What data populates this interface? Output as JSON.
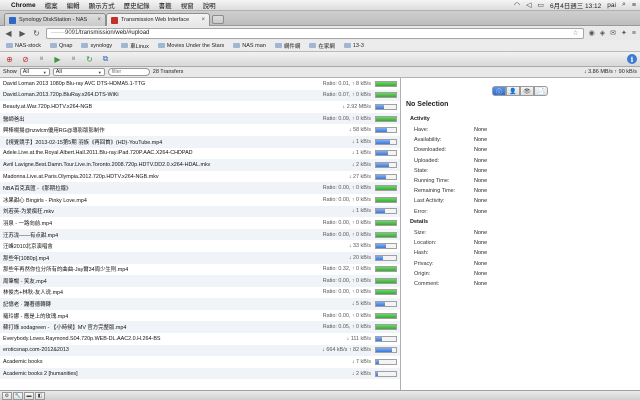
{
  "menubar": {
    "app_name": "Chrome",
    "items": [
      "檔案",
      "編輯",
      "顯示方式",
      "歷史紀錄",
      "書籤",
      "視窗",
      "說明"
    ],
    "clock": "6月4日週三 13:12",
    "user": "pai"
  },
  "tabs": [
    {
      "title": "Synology DiskStation - NAS",
      "close": "×",
      "favicon_color": "#2f67c4"
    },
    {
      "title": "Transmission Web Interface",
      "close": "×",
      "favicon_color": "#c4302b"
    }
  ],
  "address": {
    "url_host": "·······9091",
    "url_path": "/transmission/web/#upload"
  },
  "bookmarks": [
    "NAS-stock",
    "Qnap",
    "synology",
    "車Linux",
    "Movies Under the Stars",
    "NAS man",
    "網件網",
    "在家網",
    "13-3"
  ],
  "filter": {
    "show_label": "Show",
    "status_select": "All",
    "tracker_select": "All",
    "search_placeholder": "filter",
    "count": "28 Transfers",
    "speeds": "↓ 3.86 MB/s  ↑ 90 kB/s"
  },
  "torrents": [
    {
      "name": "David Loman 2013 1080p Blu-ray AVC DTS-HDMA5.1-TTG",
      "stats": "Ratio: 0.01, ↑ 8 kB/s",
      "progress": 100,
      "state": "seed"
    },
    {
      "name": "David.Loman.2013.720p.BluRay.x264.DTS-WiKi",
      "stats": "Ratio: 0.07, ↑ 0 kB/s",
      "progress": 100,
      "state": "seed"
    },
    {
      "name": "Beauty.at.War.720p.HDTV.x264-NGB",
      "stats": "↓ 2.92 MB/s",
      "progress": 40,
      "state": "dl"
    },
    {
      "name": "醫師爸出",
      "stats": "Ratio: 0.09, ↑ 0 kB/s",
      "progress": 100,
      "state": "seed"
    },
    {
      "name": "興棒楊揚@nzwlcm優用RG@導影版影制作",
      "stats": "↓ 58 kB/s",
      "progress": 55,
      "state": "dl"
    },
    {
      "name": "【視覺競手】2013-02-15第5期 羽族《再回首》(HD)-YouTube.mp4",
      "stats": "↓ 1 kB/s",
      "progress": 70,
      "state": "dl"
    },
    {
      "name": "Adele.Live.at.the.Royal.Albert.Hall.2011.Blu-ray.iPad.720P.AAC.X264-CHDPAD",
      "stats": "↓ 1 kB/s",
      "progress": 60,
      "state": "dl"
    },
    {
      "name": "Avril Lavigne.Best.Damn.Tour.Live.in.Toronto.2008.720p.HDTV.DD2.0.x264-HDAL.mkv",
      "stats": "↓ 2 kB/s",
      "progress": 65,
      "state": "dl"
    },
    {
      "name": "Madonna.Live.at.Paris.Olympia.2012.720p.HDTV.x264-NGB.mkv",
      "stats": "↓ 27 kB/s",
      "progress": 50,
      "state": "dl"
    },
    {
      "name": "NBA百克真匯 -《那期拉攏》",
      "stats": "Ratio: 0.00, ↑ 0 kB/s",
      "progress": 100,
      "state": "seed"
    },
    {
      "name": "冰果甜心 Bingirls - Pinky Love.mp4",
      "stats": "Ratio: 0.00, ↑ 0 kB/s",
      "progress": 100,
      "state": "seed"
    },
    {
      "name": "刘若英-为爱痴狂.mkv",
      "stats": "↓ 1 kB/s",
      "progress": 45,
      "state": "dl"
    },
    {
      "name": "羽泉 - 一路向前.mp4",
      "stats": "Ratio: 0.00, ↑ 0 kB/s",
      "progress": 100,
      "state": "seed"
    },
    {
      "name": "汪苏泷——有点甜.mp4",
      "stats": "Ratio: 0.00, ↑ 0 kB/s",
      "progress": 100,
      "state": "seed"
    },
    {
      "name": "汪峰2010北京演唱會",
      "stats": "↓ 33 kB/s",
      "progress": 50,
      "state": "dl"
    },
    {
      "name": "那些年[1080p].mp4",
      "stats": "↓ 20 kB/s",
      "progress": 35,
      "state": "dl"
    },
    {
      "name": "那些年再然你位分所有的曲曲-Jay爾34周少生則.mp4",
      "stats": "Ratio: 0.32, ↑ 0 kB/s",
      "progress": 100,
      "state": "seed"
    },
    {
      "name": "周筆暢 - 笑友.mp4",
      "stats": "Ratio: 0.00, ↑ 0 kB/s",
      "progress": 100,
      "state": "seed"
    },
    {
      "name": "林俊杰+林秋-友人说.mp4",
      "stats": "Ratio: 0.00, ↑ 0 kB/s",
      "progress": 100,
      "state": "seed"
    },
    {
      "name": "記憶老 · 蹦著德轉轉",
      "stats": "↓ 5 kB/s",
      "progress": 45,
      "state": "dl"
    },
    {
      "name": "羅玲娜 - 應是上的玫瑰.mp4",
      "stats": "Ratio: 0.00, ↑ 0 kB/s",
      "progress": 100,
      "state": "seed"
    },
    {
      "name": "蘇打綠 sodagreen - 【小時候】MV 官方完整版.mp4",
      "stats": "Ratio: 0.05, ↑ 0 kB/s",
      "progress": 100,
      "state": "seed"
    },
    {
      "name": "Everybody.Loves.Raymond.S04.720p.WEB-DL.AAC2.0.H.264-BS",
      "stats": "↓ 111 kB/s",
      "progress": 30,
      "state": "dl"
    },
    {
      "name": "eroticsnap.com-2012&2013",
      "stats": "↓ 664 kB/s ↑ 82 kB/s",
      "progress": 80,
      "state": "dl"
    },
    {
      "name": "Academic books",
      "stats": "↓ 7 kB/s",
      "progress": 15,
      "state": "dl"
    },
    {
      "name": "Academic books 2 [humanities]",
      "stats": "↓ 2 kB/s",
      "progress": 12,
      "state": "dl"
    }
  ],
  "inspector": {
    "tabs": [
      "ⓘ",
      "👤",
      "👁",
      "📄"
    ],
    "title": "No Selection",
    "activity_heading": "Activity",
    "activity": [
      {
        "label": "Have:",
        "value": "None"
      },
      {
        "label": "Availability:",
        "value": "None"
      },
      {
        "label": "Downloaded:",
        "value": "None"
      },
      {
        "label": "Uploaded:",
        "value": "None"
      },
      {
        "label": "State:",
        "value": "None"
      },
      {
        "label": "Running Time:",
        "value": "None"
      },
      {
        "label": "Remaining Time:",
        "value": "None"
      },
      {
        "label": "Last Activity:",
        "value": "None"
      },
      {
        "label": "Error:",
        "value": "None"
      }
    ],
    "details_heading": "Details",
    "details": [
      {
        "label": "Size:",
        "value": "None"
      },
      {
        "label": "Location:",
        "value": "None"
      },
      {
        "label": "Hash:",
        "value": "None"
      },
      {
        "label": "Privacy:",
        "value": "None"
      },
      {
        "label": "Origin:",
        "value": "None"
      },
      {
        "label": "Comment:",
        "value": "None"
      }
    ]
  },
  "statusbar": [
    "⚙",
    "🔧",
    "▬",
    "◧"
  ]
}
